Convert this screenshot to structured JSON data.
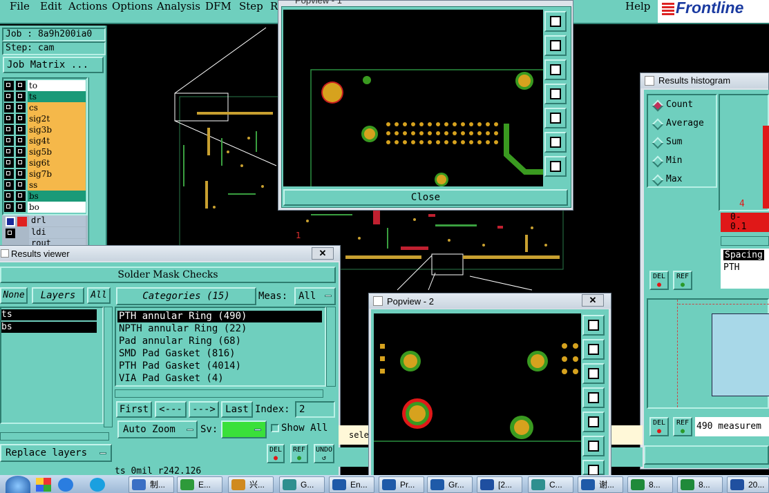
{
  "menubar": {
    "items": [
      "File",
      "Edit",
      "Actions",
      "Options",
      "Analysis",
      "DFM",
      "Step",
      "R"
    ],
    "help": "Help",
    "brand": "Frontline"
  },
  "job": {
    "job_label": "Job : 8a9h200ia0",
    "step_label": "Step: cam",
    "matrix_button": "Job Matrix ..."
  },
  "layers": [
    {
      "name": "to",
      "color": "#ffffff"
    },
    {
      "name": "ts",
      "color": "#1a9a78"
    },
    {
      "name": "cs",
      "color": "#f5b84a"
    },
    {
      "name": "sig2t",
      "color": "#f5b84a"
    },
    {
      "name": "sig3b",
      "color": "#f5b84a"
    },
    {
      "name": "sig4t",
      "color": "#f5b84a"
    },
    {
      "name": "sig5b",
      "color": "#f5b84a"
    },
    {
      "name": "sig6t",
      "color": "#f5b84a"
    },
    {
      "name": "sig7b",
      "color": "#f5b84a"
    },
    {
      "name": "ss",
      "color": "#f5b84a"
    },
    {
      "name": "bs",
      "color": "#1a9a78"
    },
    {
      "name": "bo",
      "color": "#ffffff"
    }
  ],
  "drill_layers": [
    "drl",
    "ldi",
    "rout"
  ],
  "popview1": {
    "title": "Popview - 1",
    "close": "Close"
  },
  "popview2": {
    "title": "Popview - 2",
    "close_x": "✕"
  },
  "histogram": {
    "title": "Results histogram",
    "options": [
      "Count",
      "Average",
      "Sum",
      "Min",
      "Max"
    ],
    "selected": "Count",
    "bar_label": "4",
    "range_label": "0-\n0.1",
    "info_line1": "Spacing",
    "info_line2": "PTH",
    "del": "DEL",
    "ref": "REF",
    "measure_text": "490 measurem"
  },
  "results_viewer": {
    "title": "Results viewer",
    "close_x": "✕",
    "header": "Solder Mask Checks",
    "none_btn": "None",
    "layers_btn": "Layers",
    "all_btn": "All",
    "layers_list": [
      "ts",
      "bs"
    ],
    "categories_btn": "Categories (15)",
    "meas_label": "Meas:",
    "meas_value": "All",
    "categories": [
      "PTH annular Ring (490)",
      "NPTH annular Ring (22)",
      "Pad annular Ring (68)",
      "SMD Pad Gasket (816)",
      "PTH Pad Gasket (4014)",
      "VIA Pad Gasket (4)"
    ],
    "first": "First",
    "prev": "<---",
    "next": "--->",
    "last": "Last",
    "index_label": "Index:",
    "index_value": "2",
    "auto_zoom": "Auto Zoom",
    "sv_label": "Sv:",
    "show_all": "Show All",
    "replace_layers": "Replace layers",
    "del": "DEL",
    "ref": "REF",
    "undo": "UNDO",
    "status": "ts 0mil  r242.126"
  },
  "misc_text": "sele",
  "taskbar": {
    "items": [
      {
        "label": "制...",
        "icon_color": "#3a6fc4"
      },
      {
        "label": "E...",
        "icon_color": "#2e9a3a"
      },
      {
        "label": "兴...",
        "icon_color": "#d08a20"
      },
      {
        "label": "G...",
        "icon_color": "#2f8f8f"
      },
      {
        "label": "En...",
        "icon_color": "#1f5aa8"
      },
      {
        "label": "Pr...",
        "icon_color": "#1f5aa8"
      },
      {
        "label": "Gr...",
        "icon_color": "#1f5aa8"
      },
      {
        "label": "[2...",
        "icon_color": "#1f4fa0"
      },
      {
        "label": "C...",
        "icon_color": "#2f8f8f"
      },
      {
        "label": "谢...",
        "icon_color": "#1f5aa8"
      },
      {
        "label": "8...",
        "icon_color": "#1f8a3a"
      },
      {
        "label": "8...",
        "icon_color": "#1f8a3a"
      },
      {
        "label": "20...",
        "icon_color": "#2050a0"
      }
    ]
  }
}
